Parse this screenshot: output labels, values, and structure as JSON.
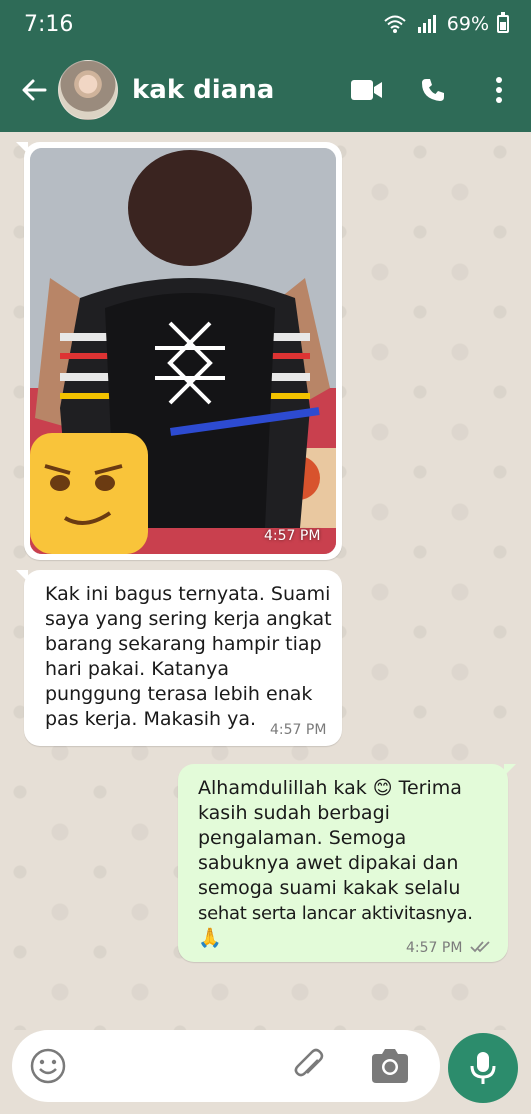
{
  "status_bar": {
    "time": "7:16",
    "battery_percent": "69%"
  },
  "header": {
    "contact_name": "kak diana"
  },
  "messages": [
    {
      "type": "image",
      "direction": "incoming",
      "time": "4:57 PM"
    },
    {
      "type": "text",
      "direction": "incoming",
      "lines": [
        "Kak ini bagus ternyata. Suami",
        "saya yang sering kerja angkat",
        "barang sekarang hampir tiap",
        "hari pakai. Katanya",
        "punggung terasa lebih enak",
        "pas kerja. Makasih ya."
      ],
      "time": "4:57 PM"
    },
    {
      "type": "text",
      "direction": "outgoing",
      "lines": [
        "Alhamdulillah kak 😊 Terima",
        "kasih sudah berbagi",
        "pengalaman. Semoga",
        "sabuknya awet dipakai dan",
        "semoga suami kakak selalu",
        "sehat serta lancar aktivitasnya.",
        "🙏"
      ],
      "time": "4:57 PM",
      "read_status": "read"
    }
  ],
  "input": {
    "placeholder": ""
  },
  "colors": {
    "header_bg": "#2e6b57",
    "chat_bg": "#e6dfd6",
    "outgoing_bubble": "#e3fbd9",
    "incoming_bubble": "#ffffff",
    "mic_button": "#2c8c6c",
    "read_ticks": "#8a8a8a"
  },
  "icons": {
    "back": "arrow-left-icon",
    "video": "video-camera-icon",
    "call": "phone-icon",
    "menu": "more-vertical-icon",
    "emoji": "smiley-icon",
    "attach": "paperclip-icon",
    "camera": "camera-icon",
    "mic": "microphone-icon",
    "wifi": "wifi-icon",
    "signal": "signal-icon",
    "battery": "battery-icon"
  }
}
